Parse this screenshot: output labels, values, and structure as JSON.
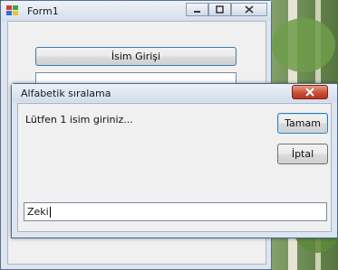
{
  "form1": {
    "title": "Form1",
    "isim_button_label": "İsim Girişi"
  },
  "dialog": {
    "title": "Alfabetik sıralama",
    "prompt": "Lütfen 1 isim giriniz...",
    "ok_label": "Tamam",
    "cancel_label": "İptal",
    "input_value": "Zeki"
  },
  "icons": {
    "app": "form-icon",
    "minimize": "minimize-icon",
    "maximize": "maximize-icon",
    "close": "close-icon"
  }
}
